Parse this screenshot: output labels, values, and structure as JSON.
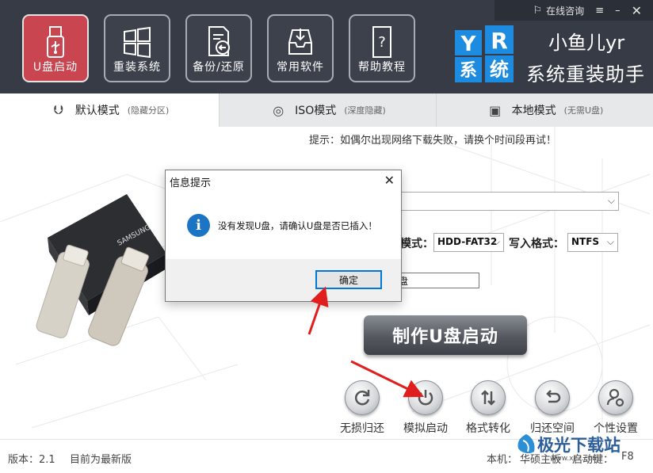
{
  "header": {
    "top_links": [
      {
        "label": "在线咨询",
        "icon": "lamp-icon"
      },
      {
        "label": "",
        "icon": "menu-icon"
      },
      {
        "label": "",
        "icon": "minimize-icon"
      },
      {
        "label": "",
        "icon": "close-icon"
      }
    ],
    "nav": [
      {
        "label": "U盘启动",
        "icon": "usb-drive-icon",
        "active": true
      },
      {
        "label": "重装系统",
        "icon": "windows-icon",
        "active": false
      },
      {
        "label": "备份/还原",
        "icon": "backup-icon",
        "active": false
      },
      {
        "label": "常用软件",
        "icon": "software-box-icon",
        "active": false
      },
      {
        "label": "帮助教程",
        "icon": "help-book-icon",
        "active": false
      }
    ],
    "brand_title": "小鱼儿yr",
    "brand_subtitle": "系统重装助手"
  },
  "tabs": [
    {
      "label": "默认模式",
      "sub": "(隐藏分区)",
      "icon": "usb-icon",
      "active": true
    },
    {
      "label": "ISO模式",
      "sub": "(深度隐藏)",
      "icon": "disc-icon",
      "active": false
    },
    {
      "label": "本地模式",
      "sub": "(无需U盘)",
      "icon": "harddisk-icon",
      "active": false
    }
  ],
  "main": {
    "tip": "提示：如偶尔出现网络下载失败，请换个时间段再试！",
    "mode_label": "模式：",
    "mode_value": "HDD-FAT32",
    "write_label": "写入格式：",
    "write_value": "NTFS",
    "partition_text": "盘",
    "make_button": "制作U盘启动",
    "tools": [
      {
        "label": "无损归还",
        "icon": "refresh-icon"
      },
      {
        "label": "模拟启动",
        "icon": "power-icon"
      },
      {
        "label": "格式转化",
        "icon": "convert-icon"
      },
      {
        "label": "归还空间",
        "icon": "return-icon"
      },
      {
        "label": "个性设置",
        "icon": "user-settings-icon"
      }
    ]
  },
  "status": {
    "version": "版本：2.1",
    "latest": "目前为最新版",
    "machine": "本机：",
    "motherboard": "华硕主板",
    "boot_key": "启动键：",
    "boot_value": "F8"
  },
  "watermark": {
    "text": "极光下载站",
    "sub": "www.xz7.com"
  },
  "dialog": {
    "title": "信息提示",
    "message": "没有发现U盘，请确认U盘是否已插入！",
    "ok": "确定",
    "icon": "info-icon"
  },
  "colors": {
    "header_bg": "#363b45",
    "active_nav": "#c9454f",
    "dialog_accent": "#0078d7",
    "arrow": "#e01e1e"
  }
}
